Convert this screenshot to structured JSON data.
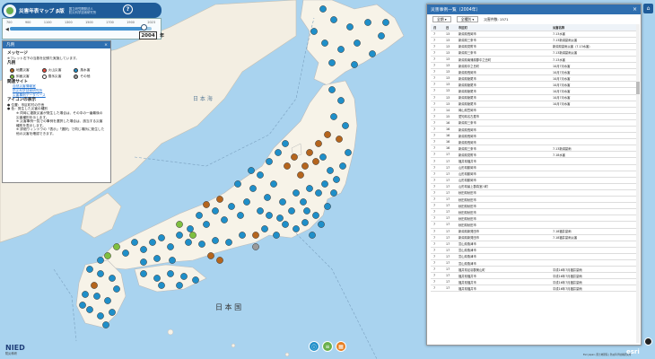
{
  "app": {
    "title": "災害年表マップ β版",
    "org_line1": "国立研究開発法人",
    "org_line2": "防災科学技術研究所",
    "help_label": "?"
  },
  "timeline": {
    "ticks": [
      "700",
      "900",
      "1100",
      "1300",
      "1500",
      "1700",
      "1900",
      "2023"
    ],
    "current_year": "2004",
    "year_suffix": "年",
    "position": 0.935
  },
  "legend_panel": {
    "title": "凡例",
    "close": "×",
    "message_heading": "メッセージ",
    "message_text": "※フレット右下の当数を記録た実施しています。",
    "legend_heading": "凡例",
    "items": [
      {
        "label": "地震災害",
        "color": "#b5651d"
      },
      {
        "label": "火山災害",
        "color": "#e94b3c"
      },
      {
        "label": "風水害",
        "color": "#1f8fc9"
      },
      {
        "label": "斜面災害",
        "color": "#7fbf3f"
      },
      {
        "label": "雪氷災害",
        "color": "#ffffff"
      },
      {
        "label": "その他",
        "color": "#9a9a9a"
      }
    ],
    "related_heading": "関連サイト",
    "links": [
      "自然災害情報室",
      "防災科学技術研究所",
      "災害事例データベース"
    ],
    "icon_heading": "アイコンの表示",
    "icon_notes": [
      "● 位置：市区町村の庁舎",
      "● 色：発生した災害の種別",
      "※ 同時に複数災害が発生した場合は、その中の一番最後の災害種別を示します。",
      "※ 災害事例一覧での事例を選択した場合は、該当する災害種別を表示します。",
      "※ 詳細ウィンドウの「表示」「選択」で同じ場所に発生した他の災害を確認できます。"
    ]
  },
  "map_labels": {
    "sea": "日 本 国",
    "sea_japan": "日 本 海"
  },
  "table_panel": {
    "title": "災害事例一覧（2004年）",
    "close": "×",
    "filter1": "全期",
    "filter2": "全種別",
    "count": "災害件数: 1571",
    "headers": [
      "月",
      "日",
      "市区町",
      "災害名称"
    ],
    "rows": [
      [
        "7",
        "13",
        "新潟県長岡市",
        "7.13水害"
      ],
      [
        "7",
        "13",
        "新潟県三条市",
        "7.13新潟豪雨災害"
      ],
      [
        "7",
        "13",
        "新潟県見附市",
        "新潟県豪雨災害（7.13水害）"
      ],
      [
        "7",
        "13",
        "新潟県三条市",
        "7.13新潟豪雨災害"
      ],
      [
        "7",
        "13",
        "新潟県南蒲原郡中之島町",
        "7.13水害"
      ],
      [
        "7",
        "13",
        "新潟県中之島町",
        "10月7月水害"
      ],
      [
        "7",
        "13",
        "新潟県長岡市",
        "10月7月水害"
      ],
      [
        "7",
        "13",
        "新潟県栃尾市",
        "10月7月水害"
      ],
      [
        "7",
        "13",
        "新潟県栃尾市",
        "10月7月水害"
      ],
      [
        "7",
        "13",
        "新潟県栃尾市",
        "10月7月水害"
      ],
      [
        "7",
        "13",
        "新潟県栃尾市",
        "10月7月水害"
      ],
      [
        "7",
        "13",
        "新潟県栃尾市",
        "10月7月水害"
      ],
      [
        "7",
        "14",
        "岡山県笠岡市",
        ""
      ],
      [
        "7",
        "15",
        "愛知県名古屋市",
        ""
      ],
      [
        "7",
        "16",
        "新潟県三条市",
        ""
      ],
      [
        "7",
        "16",
        "新潟県長岡市",
        ""
      ],
      [
        "7",
        "16",
        "新潟県長岡市",
        ""
      ],
      [
        "7",
        "16",
        "新潟県長岡市",
        ""
      ],
      [
        "7",
        "16",
        "新潟県三条市",
        "7.13新潟豪雨"
      ],
      [
        "7",
        "17",
        "新潟県見附市",
        "7.18水害"
      ],
      [
        "7",
        "17",
        "福井県福井市",
        ""
      ],
      [
        "7",
        "17",
        "山形県鶴岡市",
        ""
      ],
      [
        "7",
        "17",
        "山形県鶴岡市",
        ""
      ],
      [
        "7",
        "17",
        "山形県鶴岡市",
        ""
      ],
      [
        "7",
        "17",
        "山形県最上郡真室川町",
        ""
      ],
      [
        "7",
        "17",
        "秋田県秋田市",
        ""
      ],
      [
        "7",
        "17",
        "秋田県秋田市",
        ""
      ],
      [
        "7",
        "17",
        "秋田県秋田市",
        ""
      ],
      [
        "7",
        "17",
        "秋田県秋田市",
        ""
      ],
      [
        "7",
        "17",
        "秋田県秋田市",
        ""
      ],
      [
        "7",
        "17",
        "秋田県秋田市",
        ""
      ],
      [
        "7",
        "17",
        "新潟県新発田市",
        "7.18福井豪雨"
      ],
      [
        "7",
        "17",
        "新潟県新発田市",
        "7.18福井豪雨災害"
      ],
      [
        "7",
        "17",
        "富山県魚津市",
        ""
      ],
      [
        "7",
        "17",
        "富山県魚津市",
        ""
      ],
      [
        "7",
        "17",
        "富山県魚津市",
        ""
      ],
      [
        "7",
        "17",
        "富山県魚津市",
        ""
      ],
      [
        "7",
        "17",
        "福井県足羽郡美山町",
        "平成16年7月福井豪雨"
      ],
      [
        "7",
        "17",
        "福井県福井市",
        "平成16年7月福井豪雨"
      ],
      [
        "7",
        "17",
        "福井県福井市",
        "平成16年7月福井豪雨"
      ],
      [
        "7",
        "17",
        "福井県福井市",
        "平成16年7月福井豪雨"
      ]
    ]
  },
  "bottom_buttons": [
    {
      "icon": "info-icon",
      "color": "#1f8fc9",
      "glyph": "ⓘ"
    },
    {
      "icon": "legend-icon",
      "color": "#6ab04c",
      "glyph": "≡"
    },
    {
      "icon": "table-icon",
      "color": "#e67e22",
      "glyph": "▦"
    }
  ],
  "footer": {
    "logo_text": "NIED",
    "logo_sub": "防災科研",
    "esri": "esri",
    "attribution": "Esri Japan, 国土地理院 | 防災科学技術研究所"
  }
}
